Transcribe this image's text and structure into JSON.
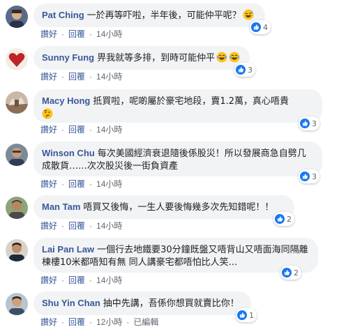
{
  "actions": {
    "like": "讚好",
    "reply": "回覆",
    "separator": "·"
  },
  "colors": {
    "author": "#385898",
    "bubble": "#f2f3f5",
    "like_blue": "#1877f2",
    "meta": "#606770"
  },
  "comments": [
    {
      "author": "Pat Ching",
      "text": "一於再等吓啦，半年後，可能仲平呢？",
      "emoji": [
        "laughing-wink-emoji"
      ],
      "reactions": "4",
      "time": "14小時"
    },
    {
      "author": "Sunny Fung",
      "text": "畀我就等多排，到時可能仲平",
      "emoji": [
        "laughing-tears-emoji",
        "laughing-tears-emoji"
      ],
      "reactions": "3",
      "time": "14小時"
    },
    {
      "author": "Macy Hong",
      "text": "抵買啦，呢啲屬於豪宅地段，賣1.2萬，真心唔貴",
      "emoji": [
        "thinking-emoji"
      ],
      "reactions": "3",
      "time": "14小時"
    },
    {
      "author": "Winson Chu",
      "text": "每次美國經濟衰退隨後係股災！所以發展商急自劈几成散貨……次次股災後一街負資產",
      "emoji": [],
      "reactions": "3",
      "time": "14小時"
    },
    {
      "author": "Man Tam",
      "text": "唔買又後悔，一生人要後悔幾多次先知錯呢！！",
      "emoji": [],
      "reactions": "2",
      "time": "14小時"
    },
    {
      "author": "Lai Pan Law",
      "text": "一個行去地鐵要30分鐘既盤又唔背山又唔面海同隔離棟樓10米都唔知有無 同人講豪宅都唔怕比人笑...",
      "emoji": [],
      "reactions": "2",
      "time": "14小時"
    },
    {
      "author": "Shu Yin Chan",
      "text": "抽中先講，吾係你想買就賣比你！",
      "emoji": [],
      "reactions": "1",
      "time": "12小時",
      "edited": "已編輯"
    }
  ]
}
